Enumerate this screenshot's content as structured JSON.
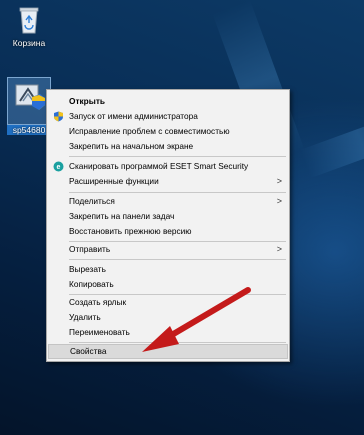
{
  "desktop": {
    "recycle_bin_label": "Корзина",
    "file_icon_label": "sp54680"
  },
  "context_menu": {
    "items": [
      {
        "label": "Открыть",
        "bold": true
      },
      {
        "label": "Запуск от имени администратора",
        "icon": "uac-shield-icon"
      },
      {
        "label": "Исправление проблем с совместимостью"
      },
      {
        "label": "Закрепить на начальном экране"
      },
      {
        "label": "Сканировать программой ESET Smart Security",
        "icon": "eset-icon"
      },
      {
        "label": "Расширенные функции",
        "submenu": true
      },
      {
        "label": "Поделиться",
        "submenu": true
      },
      {
        "label": "Закрепить на панели задач"
      },
      {
        "label": "Восстановить прежнюю версию"
      },
      {
        "label": "Отправить",
        "submenu": true
      },
      {
        "label": "Вырезать"
      },
      {
        "label": "Копировать"
      },
      {
        "label": "Создать ярлык"
      },
      {
        "label": "Удалить"
      },
      {
        "label": "Переименовать"
      },
      {
        "label": "Свойства",
        "highlighted": true
      }
    ],
    "submenu_arrow": ">"
  },
  "colors": {
    "annotation_arrow": "#c41a1a",
    "menu_background": "#f2f2f2",
    "eset_accent": "#1aa0a0",
    "uac_blue": "#2b6fd6",
    "uac_yellow": "#f2c21b"
  }
}
